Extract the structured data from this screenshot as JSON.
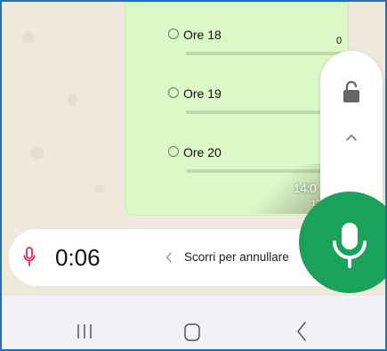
{
  "poll": {
    "options": [
      {
        "label": "Ore 18",
        "votes": "0"
      },
      {
        "label": "Ore 19"
      },
      {
        "label": "Ore 20"
      }
    ],
    "timestamp": "14:0",
    "timestamp_sub": "12"
  },
  "recording": {
    "timer": "0:06",
    "slide_hint": "Scorri per annullare"
  },
  "icons": {
    "lock": "unlock-icon",
    "chevron": "chevron-up-icon",
    "mic": "mic-icon",
    "nav_recent": "recent-apps-icon",
    "nav_home": "home-icon",
    "nav_back": "back-icon"
  },
  "colors": {
    "bubble": "#dcf8c6",
    "accent_green": "#1aa25a",
    "recording_red": "#e8274b"
  }
}
